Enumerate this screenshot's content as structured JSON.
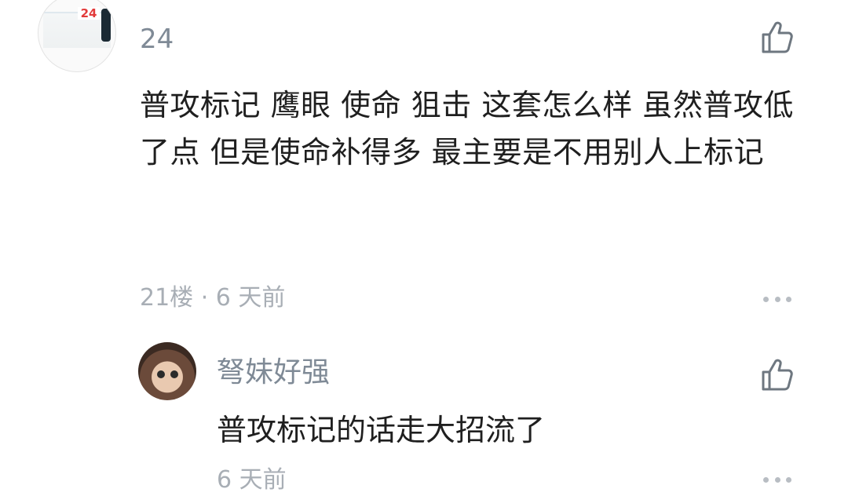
{
  "comment": {
    "username": "24",
    "avatar_tag": "24",
    "text": "普攻标记 鹰眼 使命 狙击 这套怎么样 虽然普攻低了点 但是使命补得多 最主要是不用别人上标记",
    "meta": "21楼 · 6 天前"
  },
  "reply": {
    "username": "弩妹好强",
    "text": "普攻标记的话走大招流了",
    "meta": "6 天前"
  },
  "icons": {
    "like": "thumbs-up-icon",
    "more": "more-horizontal-icon"
  },
  "colors": {
    "username": "#7f8a96",
    "body_text": "#1f1f1f",
    "meta_text": "#a8aeb5",
    "icon": "#6e7780"
  }
}
